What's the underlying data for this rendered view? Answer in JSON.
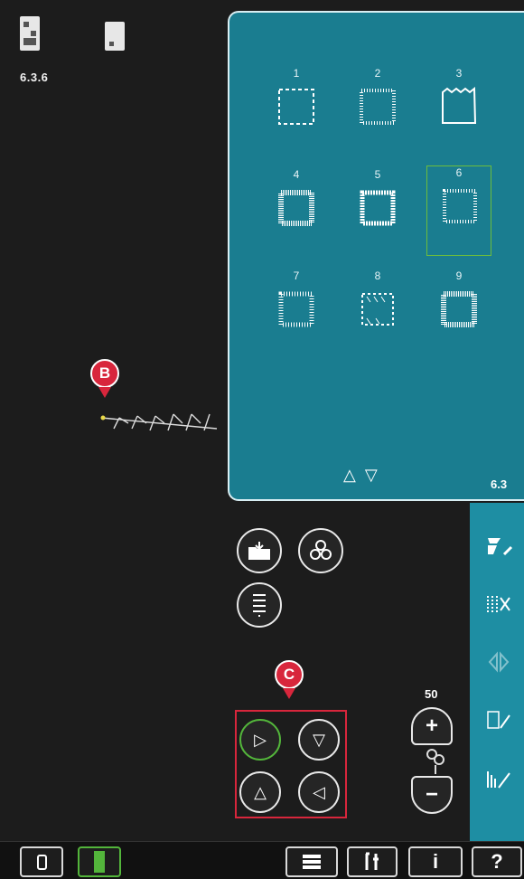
{
  "canvas": {
    "position_label": "6.3.6",
    "marker_b": "B",
    "marker_c": "C"
  },
  "quilt_menu": {
    "menu_number": "6.3",
    "stitches": [
      {
        "number": "1"
      },
      {
        "number": "2"
      },
      {
        "number": "3"
      },
      {
        "number": "4"
      },
      {
        "number": "5"
      },
      {
        "number": "6",
        "selected": true
      },
      {
        "number": "7"
      },
      {
        "number": "8"
      },
      {
        "number": "9"
      }
    ],
    "scroll_up": "△",
    "scroll_down": "▽"
  },
  "controls": {
    "zoom_value": "50",
    "zoom_in": "+",
    "zoom_out": "−"
  },
  "bottom_bar": {
    "help_label": "?",
    "info_label": "i"
  },
  "colors": {
    "panel": "#1a7d90",
    "accent_green": "#53b53b",
    "marker_red": "#d8263c"
  }
}
